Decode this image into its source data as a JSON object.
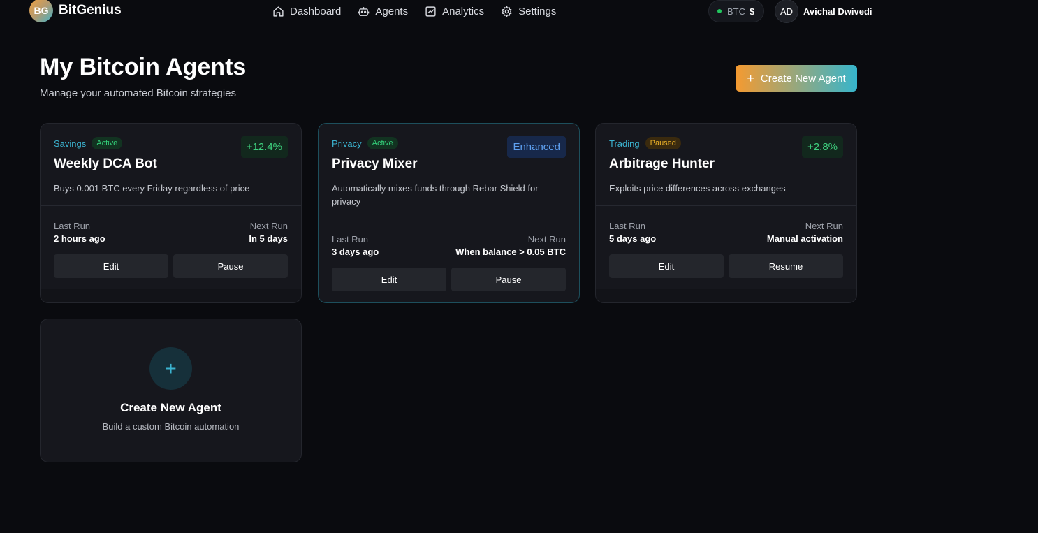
{
  "header": {
    "logo_initials": "BG",
    "brand": "BitGenius",
    "nav": [
      {
        "label": "Dashboard",
        "icon": "home-icon"
      },
      {
        "label": "Agents",
        "icon": "robot-icon"
      },
      {
        "label": "Analytics",
        "icon": "chart-icon"
      },
      {
        "label": "Settings",
        "icon": "gear-icon"
      }
    ],
    "btc_label": "BTC",
    "btc_value": "$",
    "user_initials": "AD",
    "user_name": "Avichal Dwivedi"
  },
  "page": {
    "title": "My Bitcoin Agents",
    "subtitle": "Manage your automated Bitcoin strategies",
    "create_button": "Create New Agent"
  },
  "agents": [
    {
      "category": "Savings",
      "status": "Active",
      "performance": "+12.4%",
      "name": "Weekly DCA Bot",
      "description": "Buys 0.001 BTC every Friday regardless of price",
      "last_run_label": "Last Run",
      "last_run": "2 hours ago",
      "next_run_label": "Next Run",
      "next_run": "In 5 days",
      "edit_label": "Edit",
      "action_label": "Pause"
    },
    {
      "category": "Privacy",
      "status": "Active",
      "performance": "Enhanced",
      "name": "Privacy Mixer",
      "description": "Automatically mixes funds through Rebar Shield for privacy",
      "last_run_label": "Last Run",
      "last_run": "3 days ago",
      "next_run_label": "Next Run",
      "next_run": "When balance > 0.05 BTC",
      "edit_label": "Edit",
      "action_label": "Pause"
    },
    {
      "category": "Trading",
      "status": "Paused",
      "performance": "+2.8%",
      "name": "Arbitrage Hunter",
      "description": "Exploits price differences across exchanges",
      "last_run_label": "Last Run",
      "last_run": "5 days ago",
      "next_run_label": "Next Run",
      "next_run": "Manual activation",
      "edit_label": "Edit",
      "action_label": "Resume"
    }
  ],
  "new_agent_card": {
    "title": "Create New Agent",
    "subtitle": "Build a custom Bitcoin automation"
  },
  "colors": {
    "accent_cyan": "#3bb3d0",
    "accent_orange": "#f59a30",
    "active_green": "#34d07a",
    "paused_amber": "#f0b429"
  }
}
